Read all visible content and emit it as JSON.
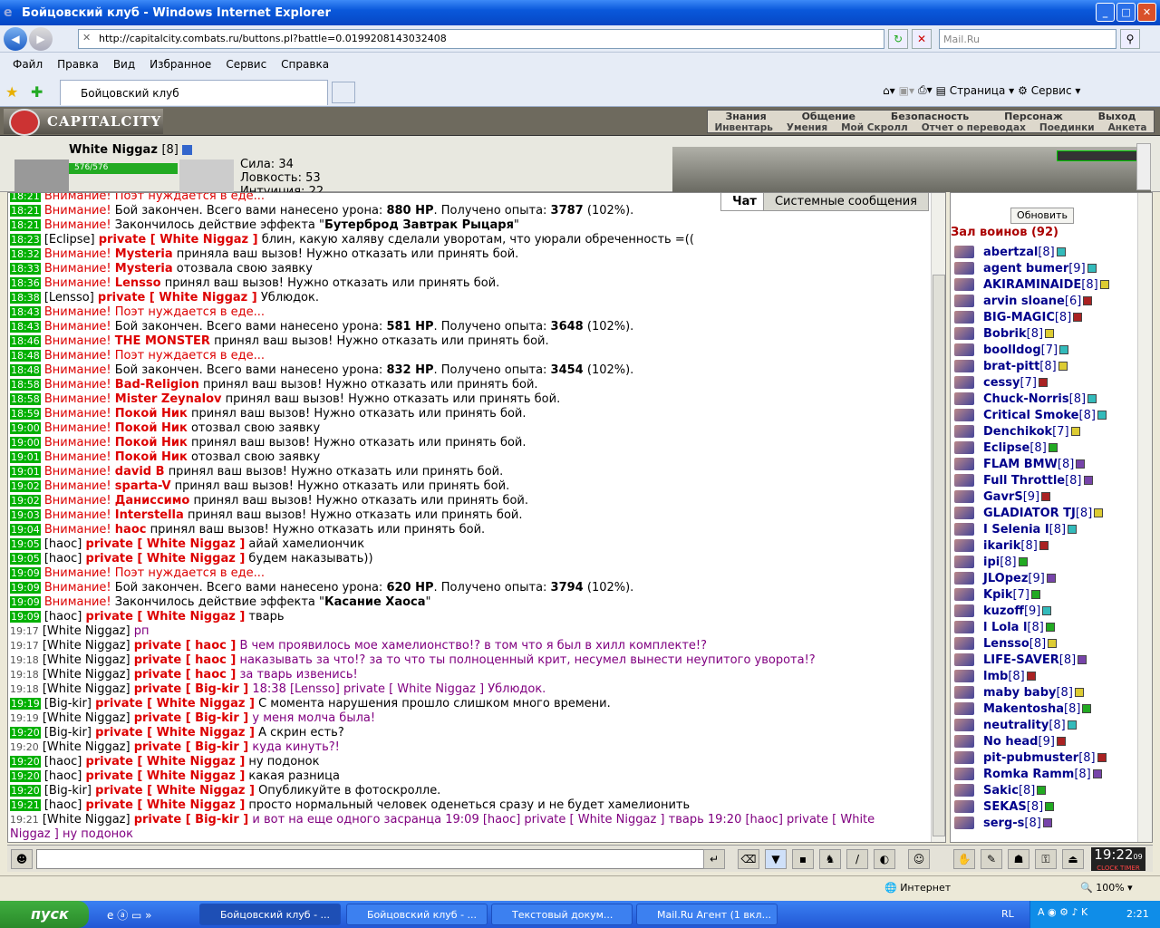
{
  "window": {
    "title": "Бойцовский клуб - Windows Internet Explorer"
  },
  "browser": {
    "url": "http://capitalcity.combats.ru/buttons.pl?battle=0.0199208143032408",
    "search_placeholder": "Mail.Ru",
    "menu": [
      "Файл",
      "Правка",
      "Вид",
      "Избранное",
      "Сервис",
      "Справка"
    ],
    "tab_title": "Бойцовский клуб",
    "toolbar": {
      "page": "Страница",
      "service": "Сервис"
    }
  },
  "game": {
    "logo": "CAPITALCITY",
    "nav_top": [
      "Знания",
      "Общение",
      "Безопасность",
      "Персонаж",
      "Выход"
    ],
    "nav_bottom": [
      "Инвентарь",
      "Умения",
      "Мой Скролл",
      "Отчет о переводах",
      "Поединки",
      "Анкета"
    ],
    "char": {
      "name": "White Niggaz",
      "level": "[8]",
      "hp": "576/576",
      "stats": [
        "Сила: 34",
        "Ловкость: 53",
        "Интуиция: 22"
      ]
    },
    "chat_tabs": [
      "Чат",
      "Системные сообщения"
    ],
    "refresh": "Обновить",
    "hall": "Зал воинов (92)",
    "clock": {
      "time": "19:22",
      "sec": "09",
      "labels": "CLOCK TIMER"
    }
  },
  "chat": [
    {
      "t": "18:21",
      "k": "w",
      "txt": "Внимание! Поэт нуждается в еде..."
    },
    {
      "t": "18:21",
      "k": "b",
      "dmg": "880 HP",
      "xp": "3787",
      "pct": "(102%)."
    },
    {
      "t": "18:21",
      "k": "e",
      "txt": "Бутерброд Завтрак Рыцаря"
    },
    {
      "t": "18:23",
      "k": "p",
      "from": "Eclipse",
      "to": "White Niggaz",
      "txt": "блин, какую халяву сделали уворотам, что уюрали обреченность =(("
    },
    {
      "t": "18:32",
      "k": "c",
      "who": "Mysteria",
      "txt": "приняла ваш вызов! Нужно отказать или принять бой."
    },
    {
      "t": "18:33",
      "k": "c",
      "who": "Mysteria",
      "txt": "отозвала свою заявку"
    },
    {
      "t": "18:36",
      "k": "c",
      "who": "Lensso",
      "txt": "принял ваш вызов! Нужно отказать или принять бой."
    },
    {
      "t": "18:38",
      "k": "p",
      "from": "Lensso",
      "to": "White Niggaz",
      "txt": "Ублюдок."
    },
    {
      "t": "18:43",
      "k": "w",
      "txt": "Внимание! Поэт нуждается в еде..."
    },
    {
      "t": "18:43",
      "k": "b",
      "dmg": "581 HP",
      "xp": "3648",
      "pct": "(102%)."
    },
    {
      "t": "18:46",
      "k": "c",
      "who": "THE MONSTER",
      "txt": "принял ваш вызов! Нужно отказать или принять бой."
    },
    {
      "t": "18:48",
      "k": "w",
      "txt": "Внимание! Поэт нуждается в еде..."
    },
    {
      "t": "18:48",
      "k": "b",
      "dmg": "832 HP",
      "xp": "3454",
      "pct": "(102%)."
    },
    {
      "t": "18:58",
      "k": "c",
      "who": "Bad-Religion",
      "txt": "принял ваш вызов! Нужно отказать или принять бой."
    },
    {
      "t": "18:58",
      "k": "c",
      "who": "Mister Zeynalov",
      "txt": "принял ваш вызов! Нужно отказать или принять бой."
    },
    {
      "t": "18:59",
      "k": "c",
      "who": "Покой Ник",
      "txt": "принял ваш вызов! Нужно отказать или принять бой."
    },
    {
      "t": "19:00",
      "k": "c",
      "who": "Покой Ник",
      "txt": "отозвал свою заявку"
    },
    {
      "t": "19:00",
      "k": "c",
      "who": "Покой Ник",
      "txt": "принял ваш вызов! Нужно отказать или принять бой."
    },
    {
      "t": "19:01",
      "k": "c",
      "who": "Покой Ник",
      "txt": "отозвал свою заявку"
    },
    {
      "t": "19:01",
      "k": "c",
      "who": "david B",
      "txt": "принял ваш вызов! Нужно отказать или принять бой."
    },
    {
      "t": "19:02",
      "k": "c",
      "who": "sparta-V",
      "txt": "принял ваш вызов! Нужно отказать или принять бой."
    },
    {
      "t": "19:02",
      "k": "c",
      "who": "Даниссимо",
      "txt": "принял ваш вызов! Нужно отказать или принять бой."
    },
    {
      "t": "19:03",
      "k": "c",
      "who": "Interstella",
      "txt": "принял ваш вызов! Нужно отказать или принять бой."
    },
    {
      "t": "19:04",
      "k": "c",
      "who": "haoc",
      "txt": "принял ваш вызов! Нужно отказать или принять бой."
    },
    {
      "t": "19:05",
      "k": "p",
      "from": "haoc",
      "to": "White Niggaz",
      "txt": "айай хамелиончик"
    },
    {
      "t": "19:05",
      "k": "p",
      "from": "haoc",
      "to": "White Niggaz",
      "txt": "будем наказывать))"
    },
    {
      "t": "19:09",
      "k": "w",
      "txt": "Внимание! Поэт нуждается в еде..."
    },
    {
      "t": "19:09",
      "k": "b",
      "dmg": "620 HP",
      "xp": "3794",
      "pct": "(102%)."
    },
    {
      "t": "19:09",
      "k": "e",
      "txt": "Касание Хаоса"
    },
    {
      "t": "19:09",
      "k": "p",
      "from": "haoc",
      "to": "White Niggaz",
      "txt": "тварь"
    },
    {
      "t": "19:17",
      "k": "m",
      "from": "White Niggaz",
      "txt": "рп"
    },
    {
      "t": "19:17",
      "k": "mp",
      "from": "White Niggaz",
      "to": "haoc",
      "txt": "В чем проявилось мое хамелионство!? в том что я был в хилл комплекте!?"
    },
    {
      "t": "19:18",
      "k": "mp",
      "from": "White Niggaz",
      "to": "haoc",
      "txt": "наказывать за что!? за то что ты полноценный крит, несумел вынести неупитого уворота!?"
    },
    {
      "t": "19:18",
      "k": "mp",
      "from": "White Niggaz",
      "to": "haoc",
      "txt": "за тварь извенись!"
    },
    {
      "t": "19:18",
      "k": "mp",
      "from": "White Niggaz",
      "to": "Big-kir",
      "txt": "18:38 [Lensso] private [ White Niggaz ] Ублюдок."
    },
    {
      "t": "19:19",
      "k": "p",
      "from": "Big-kir",
      "to": "White Niggaz",
      "txt": "С момента нарушения прошло слишком много времени."
    },
    {
      "t": "19:19",
      "k": "mp",
      "from": "White Niggaz",
      "to": "Big-kir",
      "txt": "у меня молча была!"
    },
    {
      "t": "19:20",
      "k": "p",
      "from": "Big-kir",
      "to": "White Niggaz",
      "txt": "А скрин есть?"
    },
    {
      "t": "19:20",
      "k": "mp",
      "from": "White Niggaz",
      "to": "Big-kir",
      "txt": "куда кинуть?!"
    },
    {
      "t": "19:20",
      "k": "p",
      "from": "haoc",
      "to": "White Niggaz",
      "txt": "ну подонок"
    },
    {
      "t": "19:20",
      "k": "p",
      "from": "haoc",
      "to": "White Niggaz",
      "txt": "какая разница"
    },
    {
      "t": "19:20",
      "k": "p",
      "from": "Big-kir",
      "to": "White Niggaz",
      "txt": "Опубликуйте в фотоскролле."
    },
    {
      "t": "19:21",
      "k": "p",
      "from": "haoc",
      "to": "White Niggaz",
      "txt": "просто нормальный человек оденеться сразу и не будет хамелионить"
    },
    {
      "t": "19:21",
      "k": "mp",
      "from": "White Niggaz",
      "to": "Big-kir",
      "txt": "и вот на еще одного засранца 19:09 [haoc] private [ White Niggaz ] тварь 19:20 [haoc] private [ White"
    },
    {
      "t": "",
      "k": "cont",
      "txt": "Niggaz ] ну подонок"
    }
  ],
  "users": [
    {
      "n": "abertzal",
      "l": "[8]",
      "c": "info"
    },
    {
      "n": "agent bumer",
      "l": "[9]",
      "c": "info"
    },
    {
      "n": "AKIRAMINAIDE",
      "l": "[8]",
      "c": "ylw"
    },
    {
      "n": "arvin sloane",
      "l": "[6]",
      "c": "red"
    },
    {
      "n": "BIG-MAGIC",
      "l": "[8]",
      "c": "red"
    },
    {
      "n": "Bobrik",
      "l": "[8]",
      "c": "ylw"
    },
    {
      "n": "boolldog",
      "l": "[7]",
      "c": "info"
    },
    {
      "n": "brat-pitt",
      "l": "[8]",
      "c": "ylw"
    },
    {
      "n": "cessy",
      "l": "[7]",
      "c": "red"
    },
    {
      "n": "Chuck-Norris",
      "l": "[8]",
      "c": "info"
    },
    {
      "n": "Critical Smoke",
      "l": "[8]",
      "c": "info"
    },
    {
      "n": "Denchikok",
      "l": "[7]",
      "c": "ylw"
    },
    {
      "n": "Eclipse",
      "l": "[8]",
      "c": "grn"
    },
    {
      "n": "FLAM BMW",
      "l": "[8]",
      "c": "pur"
    },
    {
      "n": "Full Throttle",
      "l": "[8]",
      "c": "pur"
    },
    {
      "n": "GavrS",
      "l": "[9]",
      "c": "red"
    },
    {
      "n": "GLADIATOR TJ",
      "l": "[8]",
      "c": "ylw"
    },
    {
      "n": "I Selenia I",
      "l": "[8]",
      "c": "info"
    },
    {
      "n": "ikarik",
      "l": "[8]",
      "c": "red"
    },
    {
      "n": "ipi",
      "l": "[8]",
      "c": "grn"
    },
    {
      "n": "JLOpez",
      "l": "[9]",
      "c": "pur"
    },
    {
      "n": "Kpik",
      "l": "[7]",
      "c": "grn"
    },
    {
      "n": "kuzoff",
      "l": "[9]",
      "c": "info"
    },
    {
      "n": "l Lola l",
      "l": "[8]",
      "c": "grn"
    },
    {
      "n": "Lensso",
      "l": "[8]",
      "c": "ylw"
    },
    {
      "n": "LIFE-SAVER",
      "l": "[8]",
      "c": "pur"
    },
    {
      "n": "lmb",
      "l": "[8]",
      "c": "red"
    },
    {
      "n": "maby baby",
      "l": "[8]",
      "c": "ylw"
    },
    {
      "n": "Makentosha",
      "l": "[8]",
      "c": "grn"
    },
    {
      "n": "neutrality",
      "l": "[8]",
      "c": "info"
    },
    {
      "n": "No head",
      "l": "[9]",
      "c": "red"
    },
    {
      "n": "pit-pubmuster",
      "l": "[8]",
      "c": "red"
    },
    {
      "n": "Romka Ramm",
      "l": "[8]",
      "c": "pur"
    },
    {
      "n": "Sakic",
      "l": "[8]",
      "c": "grn"
    },
    {
      "n": "SEKAS",
      "l": "[8]",
      "c": "grn"
    },
    {
      "n": "serg-s",
      "l": "[8]",
      "c": "pur"
    }
  ],
  "status": {
    "zone": "Интернет",
    "zoom": "100%"
  },
  "taskbar": {
    "start": "пуск",
    "tasks": [
      "Бойцовский клуб - ...",
      "Бойцовский клуб - ...",
      "Текстовый докум...",
      "Mail.Ru Агент (1 вкл..."
    ],
    "lang": "RL",
    "time": "2:21"
  }
}
